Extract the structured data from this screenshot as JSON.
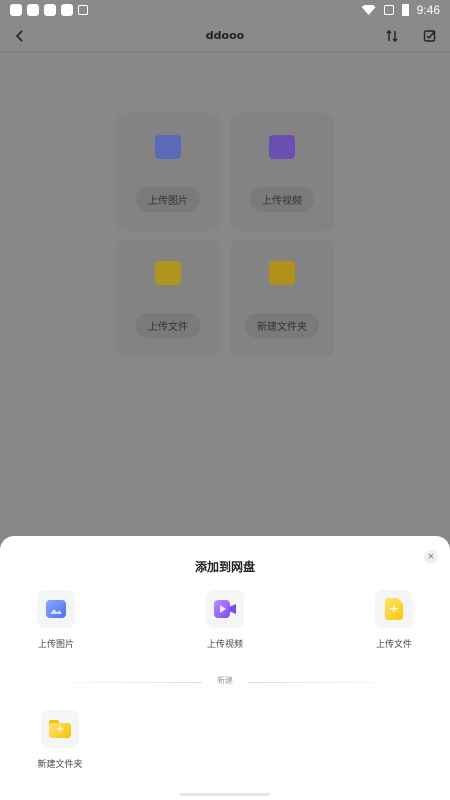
{
  "status_bar": {
    "time": "9:46"
  },
  "header": {
    "title": "ddooo"
  },
  "background_grid": [
    {
      "label": "上传图片",
      "icon": "image-icon"
    },
    {
      "label": "上传视频",
      "icon": "video-icon"
    },
    {
      "label": "上传文件",
      "icon": "file-icon"
    },
    {
      "label": "新建文件夹",
      "icon": "folder-icon"
    }
  ],
  "sheet": {
    "title": "添加到网盘",
    "close_glyph": "×",
    "upload_image": "上传图片",
    "upload_video": "上传视频",
    "upload_file": "上传文件",
    "section_label": "新建",
    "new_folder": "新建文件夹"
  },
  "colors": {
    "image": "#5b78f2",
    "video": "#8c5cf5",
    "file": "#f5c70f",
    "folder": "#f5c10a"
  }
}
